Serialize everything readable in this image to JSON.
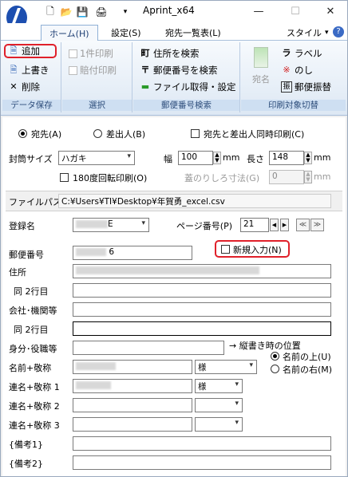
{
  "window": {
    "title": "Aprint_x64"
  },
  "tabs": [
    {
      "label": "ホーム(H)"
    },
    {
      "label": "設定(S)"
    },
    {
      "label": "宛先一覧表(L)"
    }
  ],
  "style_menu": "スタイル",
  "ribbon": {
    "data_save": {
      "add": "追加",
      "overwrite": "上書き",
      "delete": "削除",
      "label": "データ保存"
    },
    "select": {
      "print_one": "1件印刷",
      "print_chart": "賠付印刷",
      "label": "選択"
    },
    "postal": {
      "search_address": "住所を検索",
      "search_postal": "郵便番号を検索",
      "file_settings": "ファイル取得・設定",
      "label": "郵便番号検索"
    },
    "print_target": {
      "atena": "宛名",
      "label_btn": "ラベル",
      "noshi": "のし",
      "postal_transfer": "郵便振替",
      "label": "印刷対象切替"
    }
  },
  "form": {
    "radio_to": "宛先(A)",
    "radio_from": "差出人(B)",
    "simultaneous": "宛先と差出人同時印刷(C)",
    "envelope_size_label": "封筒サイズ",
    "envelope_size": "ハガキ",
    "width_label": "幅",
    "width_value": "100",
    "length_label": "長さ",
    "length_value": "148",
    "mm": "mm",
    "rotate": "180度回転印刷(O)",
    "flap_label": "蓋のりしろ寸法(G)",
    "flap_value": "0",
    "file_path_label": "ファイルパス",
    "file_path": "C:¥Users¥TI¥Desktop¥年賀勇_excel.csv",
    "reg_name_label": "登録名",
    "reg_name_value": "E",
    "page_label": "ページ番号(P)",
    "page_value": "21",
    "new_entry": "新規入力(N)",
    "postal_code_label": "郵便番号",
    "postal_code_value": "6",
    "address_label": "住所",
    "address_line2_label": "同 2行目",
    "company_label": "会社･機関等",
    "company_line2_label": "同 2行目",
    "title_label": "身分･役職等",
    "vertical_note": "→ 縦書き時の位置",
    "name_label": "名前+敬称",
    "honorific": "様",
    "pos_top": "名前の上(U)",
    "pos_right": "名前の右(M)",
    "joint1_label": "連名+敬称 1",
    "joint1_honorific": "様",
    "joint2_label": "連名+敬称 2",
    "joint3_label": "連名+敬称 3",
    "note1_label": "{備考1}",
    "note2_label": "{備考2}"
  },
  "colors": {
    "highlight": "#e0202a",
    "ribbon_label": "#cedff2",
    "tab_text": "#1f3f74"
  }
}
